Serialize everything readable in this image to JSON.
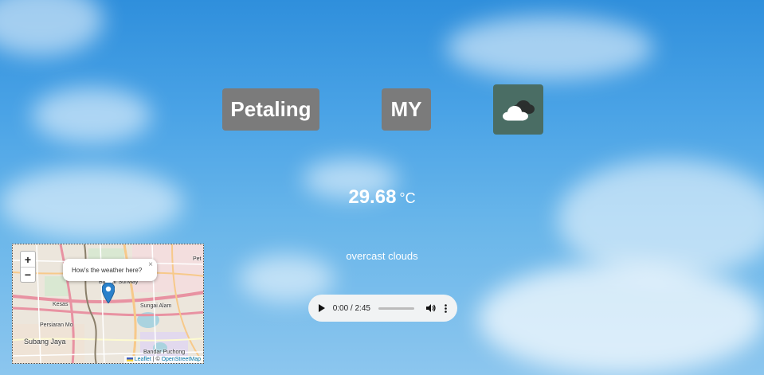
{
  "location": {
    "city": "Petaling",
    "country": "MY"
  },
  "weather": {
    "icon": "overcast-clouds-icon",
    "temperature": "29.68",
    "unit": "°C",
    "description": "overcast clouds"
  },
  "audio": {
    "time": "0:00 / 2:45",
    "progress": 0
  },
  "map": {
    "zoom_in": "+",
    "zoom_out": "−",
    "popup_text": "How's the weather here?",
    "popup_close": "×",
    "labels": {
      "bandar_sunway": "Bandar Sunway",
      "subang_jaya": "Subang Jaya",
      "bandar_puchong": "Bandar Puchong",
      "persiaran_mokhtar": "Persiaran Mo",
      "kesas": "Kesas",
      "pet": "Pet",
      "sungai_alam": "Sungai Alam"
    },
    "attribution": {
      "leaflet": "Leaflet",
      "separator": " | © ",
      "osm": "OpenStreetMap"
    }
  },
  "colors": {
    "card_bg": "#7b7b7b",
    "icon_bg": "#4a6d64",
    "sky": "#4aa3e6"
  }
}
